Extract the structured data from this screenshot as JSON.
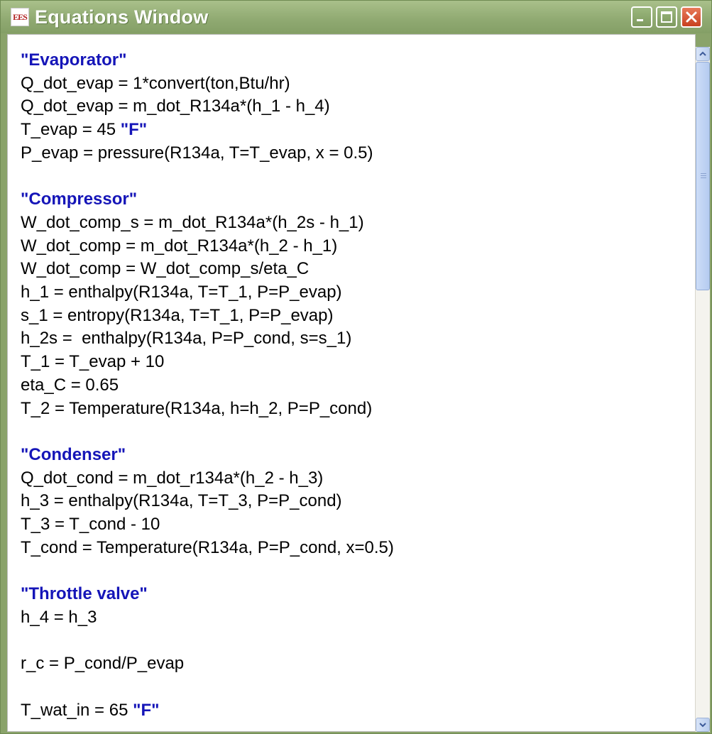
{
  "window": {
    "icon_text": "EES",
    "title": "Equations Window"
  },
  "controls": {
    "colors": {
      "titlebar": "#8fa971",
      "close": "#c8401f",
      "comment": "#1515b8"
    }
  },
  "lines": [
    {
      "type": "comment",
      "parts": [
        {
          "text": "\"Evaporator\"",
          "style": "comment"
        }
      ]
    },
    {
      "type": "code",
      "parts": [
        {
          "text": "Q_dot_evap = 1*convert(ton,Btu/hr)"
        }
      ]
    },
    {
      "type": "code",
      "parts": [
        {
          "text": "Q_dot_evap = m_dot_R134a*(h_1 - h_4)"
        }
      ]
    },
    {
      "type": "code",
      "parts": [
        {
          "text": "T_evap = 45 "
        },
        {
          "text": "\"F\"",
          "style": "comment"
        }
      ]
    },
    {
      "type": "code",
      "parts": [
        {
          "text": "P_evap = pressure(R134a, T=T_evap, x = 0.5)"
        }
      ]
    },
    {
      "type": "blank",
      "parts": []
    },
    {
      "type": "comment",
      "parts": [
        {
          "text": "\"Compressor\"",
          "style": "comment"
        }
      ]
    },
    {
      "type": "code",
      "parts": [
        {
          "text": "W_dot_comp_s = m_dot_R134a*(h_2s - h_1)"
        }
      ]
    },
    {
      "type": "code",
      "parts": [
        {
          "text": "W_dot_comp = m_dot_R134a*(h_2 - h_1)"
        }
      ]
    },
    {
      "type": "code",
      "parts": [
        {
          "text": "W_dot_comp = W_dot_comp_s/eta_C"
        }
      ]
    },
    {
      "type": "code",
      "parts": [
        {
          "text": "h_1 = enthalpy(R134a, T=T_1, P=P_evap)"
        }
      ]
    },
    {
      "type": "code",
      "parts": [
        {
          "text": "s_1 = entropy(R134a, T=T_1, P=P_evap)"
        }
      ]
    },
    {
      "type": "code",
      "parts": [
        {
          "text": "h_2s =  enthalpy(R134a, P=P_cond, s=s_1)"
        }
      ]
    },
    {
      "type": "code",
      "parts": [
        {
          "text": "T_1 = T_evap + 10"
        }
      ]
    },
    {
      "type": "code",
      "parts": [
        {
          "text": "eta_C = 0.65"
        }
      ]
    },
    {
      "type": "code",
      "parts": [
        {
          "text": "T_2 = Temperature(R134a, h=h_2, P=P_cond)"
        }
      ]
    },
    {
      "type": "blank",
      "parts": []
    },
    {
      "type": "comment",
      "parts": [
        {
          "text": "\"Condenser\"",
          "style": "comment"
        }
      ]
    },
    {
      "type": "code",
      "parts": [
        {
          "text": "Q_dot_cond = m_dot_r134a*(h_2 - h_3)"
        }
      ]
    },
    {
      "type": "code",
      "parts": [
        {
          "text": "h_3 = enthalpy(R134a, T=T_3, P=P_cond)"
        }
      ]
    },
    {
      "type": "code",
      "parts": [
        {
          "text": "T_3 = T_cond - 10"
        }
      ]
    },
    {
      "type": "code",
      "parts": [
        {
          "text": "T_cond = Temperature(R134a, P=P_cond, x=0.5)"
        }
      ]
    },
    {
      "type": "blank",
      "parts": []
    },
    {
      "type": "comment",
      "parts": [
        {
          "text": "\"Throttle valve\"",
          "style": "comment"
        }
      ]
    },
    {
      "type": "code",
      "parts": [
        {
          "text": "h_4 = h_3"
        }
      ]
    },
    {
      "type": "blank",
      "parts": []
    },
    {
      "type": "code",
      "parts": [
        {
          "text": "r_c = P_cond/P_evap"
        }
      ]
    },
    {
      "type": "blank",
      "parts": []
    },
    {
      "type": "code",
      "parts": [
        {
          "text": "T_wat_in = 65 "
        },
        {
          "text": "\"F\"",
          "style": "comment"
        }
      ]
    }
  ]
}
